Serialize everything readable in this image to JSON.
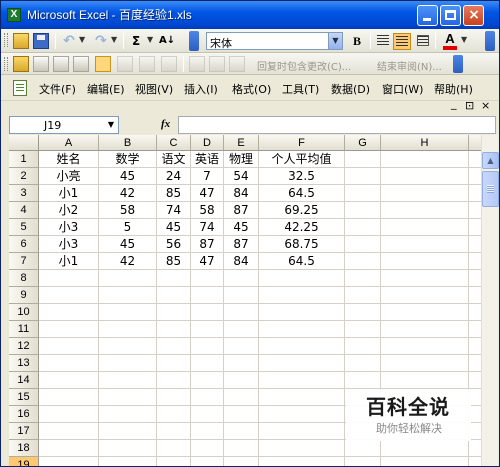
{
  "window": {
    "title": "Microsoft Excel - 百度经验1.xls",
    "app_icon_glyph": "X",
    "close_glyph": "×"
  },
  "toolbar": {
    "sum_label": "Σ",
    "sort_label": "A↓",
    "font_name": "宋体",
    "bold_label": "B",
    "font_color_label": "A",
    "dropdown_glyph": "▼",
    "undo_glyph": "↶",
    "redo_glyph": "↷"
  },
  "review_toolbar": {
    "reply_text": "回复时包含更改(C)...",
    "end_review_text": "结束审阅(N)..."
  },
  "menu": {
    "items": [
      "文件(F)",
      "编辑(E)",
      "视图(V)",
      "插入(I)",
      "格式(O)",
      "工具(T)",
      "数据(D)",
      "窗口(W)",
      "帮助(H)"
    ],
    "mdi": [
      "_",
      "⊡",
      "×"
    ]
  },
  "formula_bar": {
    "name_box": "J19",
    "fx_label": "fx",
    "formula": ""
  },
  "sheet": {
    "columns": [
      "A",
      "B",
      "C",
      "D",
      "E",
      "F",
      "G",
      "H"
    ],
    "rows": [
      "1",
      "2",
      "3",
      "4",
      "5",
      "6",
      "7",
      "8",
      "9",
      "10",
      "11",
      "12",
      "13",
      "14",
      "15",
      "16",
      "17",
      "18",
      "19"
    ],
    "active_row": "19",
    "cells": [
      [
        "姓名",
        "数学",
        "语文",
        "英语",
        "物理",
        "个人平均值"
      ],
      [
        "小亮",
        "45",
        "24",
        "7",
        "54",
        "32.5"
      ],
      [
        "小1",
        "42",
        "85",
        "47",
        "84",
        "64.5"
      ],
      [
        "小2",
        "58",
        "74",
        "58",
        "87",
        "69.25"
      ],
      [
        "小3",
        "5",
        "45",
        "74",
        "45",
        "42.25"
      ],
      [
        "小3",
        "45",
        "56",
        "87",
        "87",
        "68.75"
      ],
      [
        "小1",
        "42",
        "85",
        "47",
        "84",
        "64.5"
      ]
    ]
  },
  "scrollbar": {
    "up_glyph": "▲"
  },
  "watermark": {
    "main": "百科全说",
    "sub": "助你轻松解决"
  }
}
